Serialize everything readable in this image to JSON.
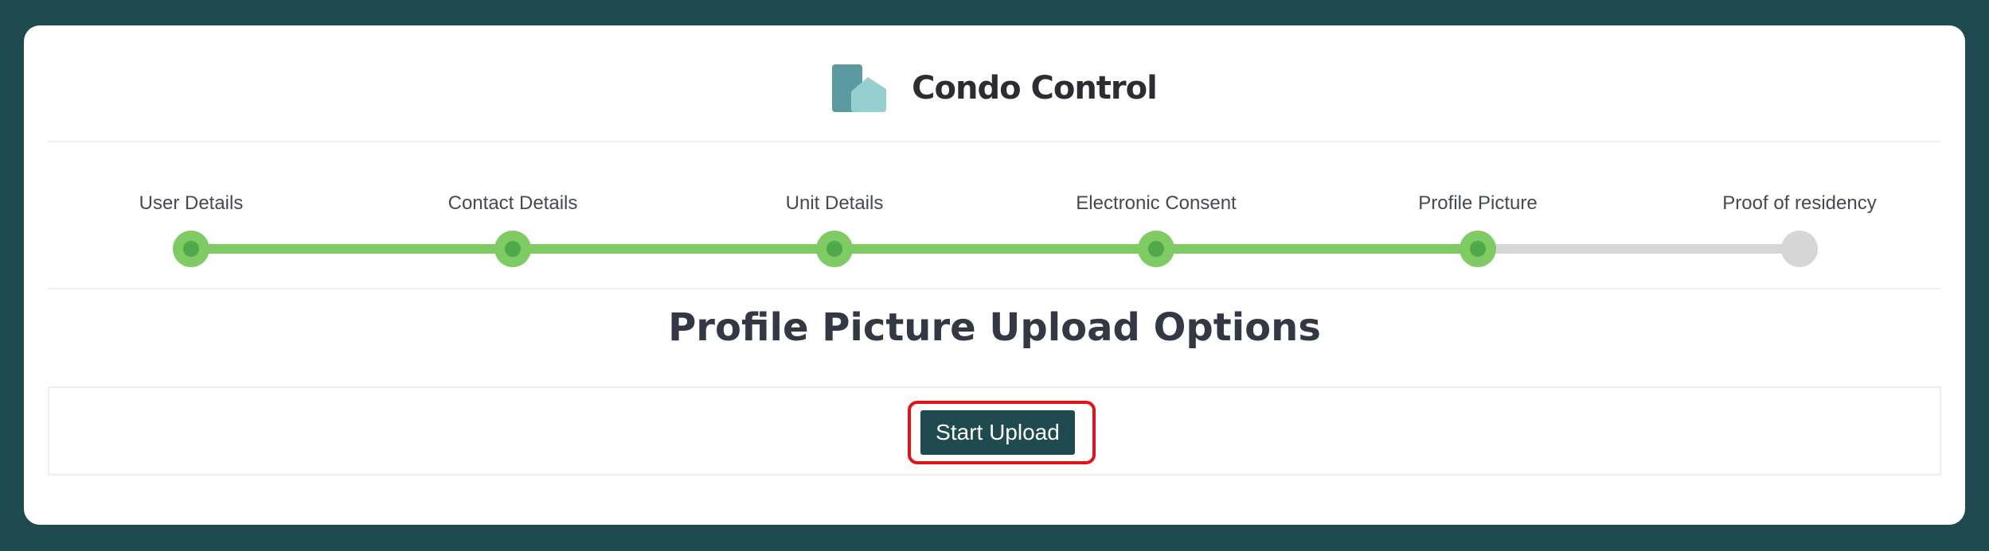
{
  "brand": {
    "name": "Condo Control",
    "logo_colors": {
      "back": "#5a9aa0",
      "front": "#96cfd0"
    }
  },
  "stepper": {
    "steps": [
      {
        "label": "User Details",
        "completed": true
      },
      {
        "label": "Contact Details",
        "completed": true
      },
      {
        "label": "Unit Details",
        "completed": true
      },
      {
        "label": "Electronic Consent",
        "completed": true
      },
      {
        "label": "Profile Picture",
        "completed": true
      },
      {
        "label": "Proof of residency",
        "completed": false
      }
    ],
    "colors": {
      "done": "#7dcb62",
      "pending": "#d6d6d6"
    }
  },
  "page": {
    "heading": "Profile Picture Upload Options"
  },
  "upload": {
    "button_label": "Start Upload",
    "highlighted": true,
    "highlight_color": "#e3111b"
  },
  "colors": {
    "background": "#1f4a50",
    "card": "#ffffff",
    "button": "#1f4a50"
  }
}
